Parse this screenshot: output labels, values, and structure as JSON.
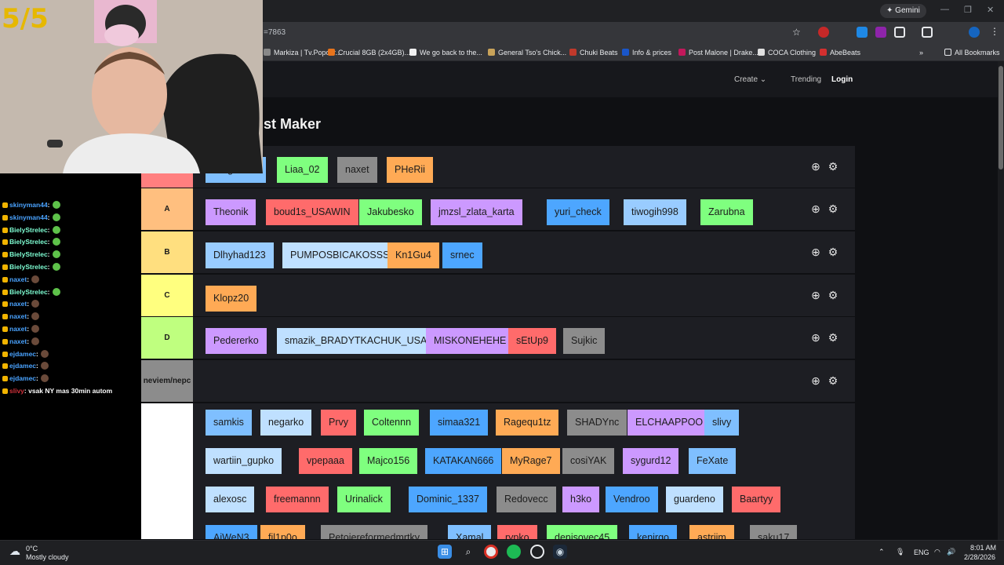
{
  "browser": {
    "gemini_label": "Gemini",
    "url_fragment": "=7863",
    "bookmarks": [
      {
        "label": "Markiza | Tv.Popcor...",
        "color": "#888888"
      },
      {
        "label": "Crucial 8GB (2x4GB)...",
        "color": "#e8741c"
      },
      {
        "label": "We go back to the...",
        "color": "#f1f1f1"
      },
      {
        "label": "General Tso's Chick...",
        "color": "#c9a35a"
      },
      {
        "label": "Chuki Beats",
        "color": "#c0392b"
      },
      {
        "label": "Info & prices",
        "color": "#1a56c9"
      },
      {
        "label": "Post Malone | Drake...",
        "color": "#c2185b"
      },
      {
        "label": "COCA Clothing",
        "color": "#e0e0e0"
      },
      {
        "label": "AbeBeats",
        "color": "#d32f2f"
      }
    ],
    "all_bookmarks_label": "All Bookmarks"
  },
  "site": {
    "nav": {
      "create": "Create",
      "trending": "Trending",
      "login": "Login"
    },
    "title": "st Maker"
  },
  "tiers": [
    {
      "label": "",
      "color": "#ff7f7f",
      "chips": [
        {
          "text": "reaganr00",
          "color": "#7fbfff"
        },
        {
          "text": "Liaa_02",
          "color": "#7fff7f"
        },
        {
          "text": "naxet",
          "color": "#8c8c8c"
        },
        {
          "text": "PHeRii",
          "color": "#ffaa55"
        }
      ]
    },
    {
      "label": "A",
      "color": "#ffbf7f",
      "chips": [
        {
          "text": "Theonik",
          "color": "#cc99ff"
        },
        {
          "text": "boud1s_USAWIN",
          "color": "#ff6b6b"
        },
        {
          "text": "Jakubesko",
          "color": "#7fff7f"
        },
        {
          "text": "jmzsl_zlata_karta",
          "color": "#cc99ff"
        },
        {
          "text": "yuri_check",
          "color": "#4da6ff"
        },
        {
          "text": "tiwogih998",
          "color": "#99ccff"
        },
        {
          "text": "Zarubna",
          "color": "#7fff7f"
        }
      ]
    },
    {
      "label": "B",
      "color": "#ffdf7f",
      "chips": [
        {
          "text": "Dlhyhad123",
          "color": "#99ccff"
        },
        {
          "text": "PUMPOSBICAKOSSS",
          "color": "#bfe0ff"
        },
        {
          "text": "Kn1Gu4",
          "color": "#ffaa55"
        },
        {
          "text": "srnec",
          "color": "#4da6ff"
        }
      ]
    },
    {
      "label": "C",
      "color": "#ffff7f",
      "chips": [
        {
          "text": "Klopz20",
          "color": "#ffaa55"
        }
      ]
    },
    {
      "label": "D",
      "color": "#bfff7f",
      "chips": [
        {
          "text": "Pedererko",
          "color": "#cc99ff"
        },
        {
          "text": "smazik_BRADYTKACHUK_USA",
          "color": "#bfe0ff"
        },
        {
          "text": "MISKONEHEHE",
          "color": "#cc99ff"
        },
        {
          "text": "sEtUp9",
          "color": "#ff6b6b"
        },
        {
          "text": "Sujkic",
          "color": "#8c8c8c"
        }
      ]
    },
    {
      "label": "neviem/nepc",
      "color": "#8c8c8c",
      "chips": []
    }
  ],
  "pool": [
    [
      {
        "text": "samkis",
        "color": "#7fbfff"
      },
      {
        "text": "negarko",
        "color": "#bfe0ff"
      },
      {
        "text": "Prvy",
        "color": "#ff6b6b"
      },
      {
        "text": "Coltennn",
        "color": "#7fff7f"
      },
      {
        "text": "simaa321",
        "color": "#4da6ff"
      },
      {
        "text": "Ragequ1tz",
        "color": "#ffaa55"
      },
      {
        "text": "SHADYnc",
        "color": "#8c8c8c"
      },
      {
        "text": "ELCHAAPPOO",
        "color": "#cc99ff"
      },
      {
        "text": "slivy",
        "color": "#7fbfff"
      }
    ],
    [
      {
        "text": "wartiin_gupko",
        "color": "#bfe0ff"
      },
      {
        "text": "vpepaaa",
        "color": "#ff6b6b"
      },
      {
        "text": "Majco156",
        "color": "#7fff7f"
      },
      {
        "text": "KATAKAN666",
        "color": "#4da6ff"
      },
      {
        "text": "MyRage7",
        "color": "#ffaa55"
      },
      {
        "text": "cosiYAK",
        "color": "#8c8c8c"
      },
      {
        "text": "sygurd12",
        "color": "#cc99ff"
      },
      {
        "text": "FeXate",
        "color": "#7fbfff"
      }
    ],
    [
      {
        "text": "alexosc",
        "color": "#bfe0ff"
      },
      {
        "text": "freemannn",
        "color": "#ff6b6b"
      },
      {
        "text": "Urinalick",
        "color": "#7fff7f"
      },
      {
        "text": "Dominic_1337",
        "color": "#4da6ff"
      },
      {
        "text": "Redovecc",
        "color": "#8c8c8c"
      },
      {
        "text": "h3ko",
        "color": "#cc99ff"
      },
      {
        "text": "Vendroo",
        "color": "#4da6ff"
      },
      {
        "text": "guardeno",
        "color": "#bfe0ff"
      },
      {
        "text": "Baartyy",
        "color": "#ff6b6b"
      }
    ],
    [
      {
        "text": "AiWeN3",
        "color": "#4da6ff"
      },
      {
        "text": "fil1p0o",
        "color": "#ffaa55"
      },
      {
        "text": "Petojereformedmrtky",
        "color": "#8c8c8c"
      },
      {
        "text": "Xamal",
        "color": "#7fbfff"
      },
      {
        "text": "rypko",
        "color": "#ff6b6b"
      },
      {
        "text": "denisovec45",
        "color": "#7fff7f"
      },
      {
        "text": "kenirgo",
        "color": "#4da6ff"
      },
      {
        "text": "astriim",
        "color": "#ffaa55"
      },
      {
        "text": "saku17",
        "color": "#8c8c8c"
      }
    ]
  ],
  "stream": {
    "counter": "5/5",
    "chat": [
      {
        "user": "skinyman44",
        "msg": ":",
        "color": "#4aa3ff"
      },
      {
        "user": "skinyman44",
        "msg": ":",
        "color": "#4aa3ff"
      },
      {
        "user": "BielyStrelec",
        "msg": ":",
        "color": "#7fffd4"
      },
      {
        "user": "BielyStrelec",
        "msg": ":",
        "color": "#7fffd4"
      },
      {
        "user": "BielyStrelec",
        "msg": ":",
        "color": "#7fffd4"
      },
      {
        "user": "BielyStrelec",
        "msg": ":",
        "color": "#7fffd4"
      },
      {
        "user": "naxet",
        "msg": ":",
        "color": "#4aa3ff"
      },
      {
        "user": "BielyStrelec",
        "msg": ":",
        "color": "#7fffd4"
      },
      {
        "user": "naxet",
        "msg": ":",
        "color": "#4aa3ff"
      },
      {
        "user": "naxet",
        "msg": ":",
        "color": "#4aa3ff"
      },
      {
        "user": "naxet",
        "msg": ":",
        "color": "#4aa3ff"
      },
      {
        "user": "naxet",
        "msg": ":",
        "color": "#4aa3ff"
      },
      {
        "user": "ejdamec",
        "msg": ":",
        "color": "#4aa3ff"
      },
      {
        "user": "ejdamec",
        "msg": ":",
        "color": "#4aa3ff"
      },
      {
        "user": "ejdamec",
        "msg": ":",
        "color": "#4aa3ff"
      },
      {
        "user": "slivy",
        "msg": ": vsak NY mas 30min autom",
        "color": "#d0303a"
      }
    ]
  },
  "taskbar": {
    "weather_temp": "0°C",
    "weather_desc": "Mostly cloudy",
    "lang": "ENG",
    "time": "8:01 AM",
    "date": "2/28/2026"
  }
}
